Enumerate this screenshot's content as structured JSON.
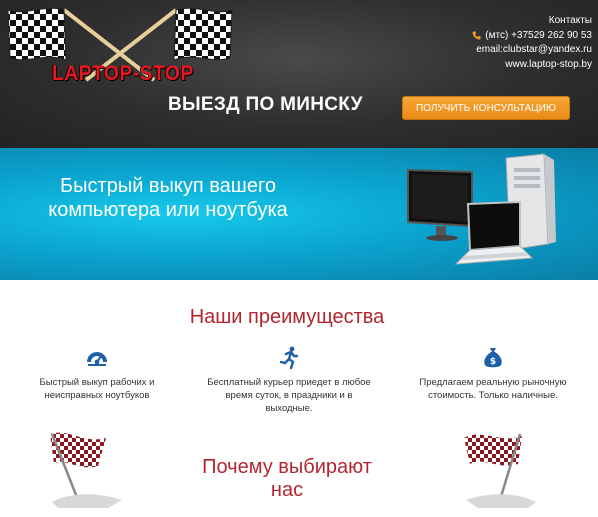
{
  "header": {
    "logo_text": "LAPTOP-STOP",
    "contacts_title": "Контакты",
    "phone": "(мтс) +37529 262 90 53",
    "email": "email:clubstar@yandex.ru",
    "website": "www.laptop-stop.by",
    "tagline": "ВЫЕЗД ПО МИНСКУ",
    "cta_label": "ПОЛУЧИТЬ КОНСУЛЬТАЦИЮ"
  },
  "banner": {
    "title": "Быстрый выкуп вашего компьютера или ноутбука"
  },
  "advantages": {
    "title": "Наши преимущества",
    "items": [
      {
        "icon": "speedometer-icon",
        "text": "Быстрый выкуп рабочих и неисправных ноутбуков"
      },
      {
        "icon": "running-man-icon",
        "text": "Бесплатный курьер приедет в любое время суток, в праздники и в выходные."
      },
      {
        "icon": "money-bag-icon",
        "text": "Предлагаем реальную рыночную стоимость. Только наличные."
      }
    ]
  },
  "why": {
    "title_line1": "Почему выбирают",
    "title_line2": "нас"
  },
  "colors": {
    "accent_orange": "#f19a26",
    "heading_red": "#b3262e",
    "icon_blue": "#1f5fa8",
    "banner_blue": "#0aa4cf"
  }
}
